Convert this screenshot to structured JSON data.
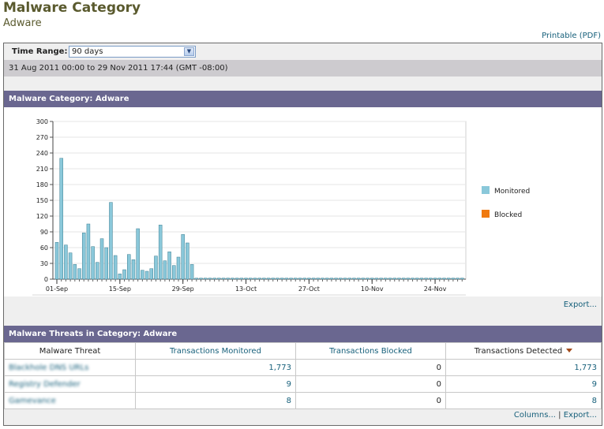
{
  "page": {
    "title": "Malware Category",
    "subtitle": "Adware",
    "printable_label": "Printable (PDF)"
  },
  "time_range": {
    "label": "Time Range:",
    "selected": "90 days",
    "date_range": "31 Aug 2011 00:00 to 29 Nov 2011 17:44 (GMT -08:00)"
  },
  "chart_section": {
    "header": "Malware Category: Adware",
    "export_label": "Export..."
  },
  "colors": {
    "monitored": "#8ac8da",
    "blocked": "#f07a10",
    "header_bg": "#6a6790",
    "link": "#17607b"
  },
  "chart_data": {
    "type": "bar",
    "ylim": [
      0,
      300
    ],
    "yticks": [
      "0",
      "30",
      "60",
      "90",
      "120",
      "150",
      "180",
      "210",
      "240",
      "270",
      "300"
    ],
    "xticks": [
      "01-Sep",
      "15-Sep",
      "29-Sep",
      "13-Oct",
      "27-Oct",
      "10-Nov",
      "24-Nov"
    ],
    "grid": true,
    "legend_position": "right",
    "series": [
      {
        "name": "Monitored",
        "values": [
          70,
          230,
          65,
          50,
          28,
          20,
          88,
          105,
          62,
          32,
          77,
          60,
          146,
          45,
          10,
          18,
          47,
          37,
          96,
          17,
          15,
          20,
          44,
          103,
          35,
          52,
          26,
          42,
          85,
          69,
          28,
          2,
          2,
          2,
          2,
          2,
          2,
          2,
          2,
          2,
          2,
          2,
          2,
          2,
          2,
          2,
          2,
          2,
          2,
          2,
          2,
          2,
          2,
          2,
          2,
          2,
          2,
          2,
          2,
          2,
          2,
          2,
          2,
          2,
          2,
          2,
          2,
          2,
          2,
          2,
          2,
          2,
          2,
          2,
          2,
          2,
          2,
          2,
          2,
          2,
          2,
          2,
          2,
          2,
          2,
          2,
          2,
          2,
          2,
          2,
          2
        ]
      },
      {
        "name": "Blocked",
        "values": []
      }
    ]
  },
  "threats_section": {
    "header": "Malware Threats in Category: Adware",
    "columns": [
      "Malware Threat",
      "Transactions Monitored",
      "Transactions Blocked",
      "Transactions Detected"
    ],
    "rows": [
      {
        "threat": "Blackhole DNS URLs",
        "monitored": "1,773",
        "blocked": "0",
        "detected": "1,773"
      },
      {
        "threat": "Registry Defender",
        "monitored": "9",
        "blocked": "0",
        "detected": "9"
      },
      {
        "threat": "Gamevance",
        "monitored": "8",
        "blocked": "0",
        "detected": "8"
      }
    ],
    "columns_link": "Columns...",
    "separator": "|",
    "export_label": "Export..."
  }
}
